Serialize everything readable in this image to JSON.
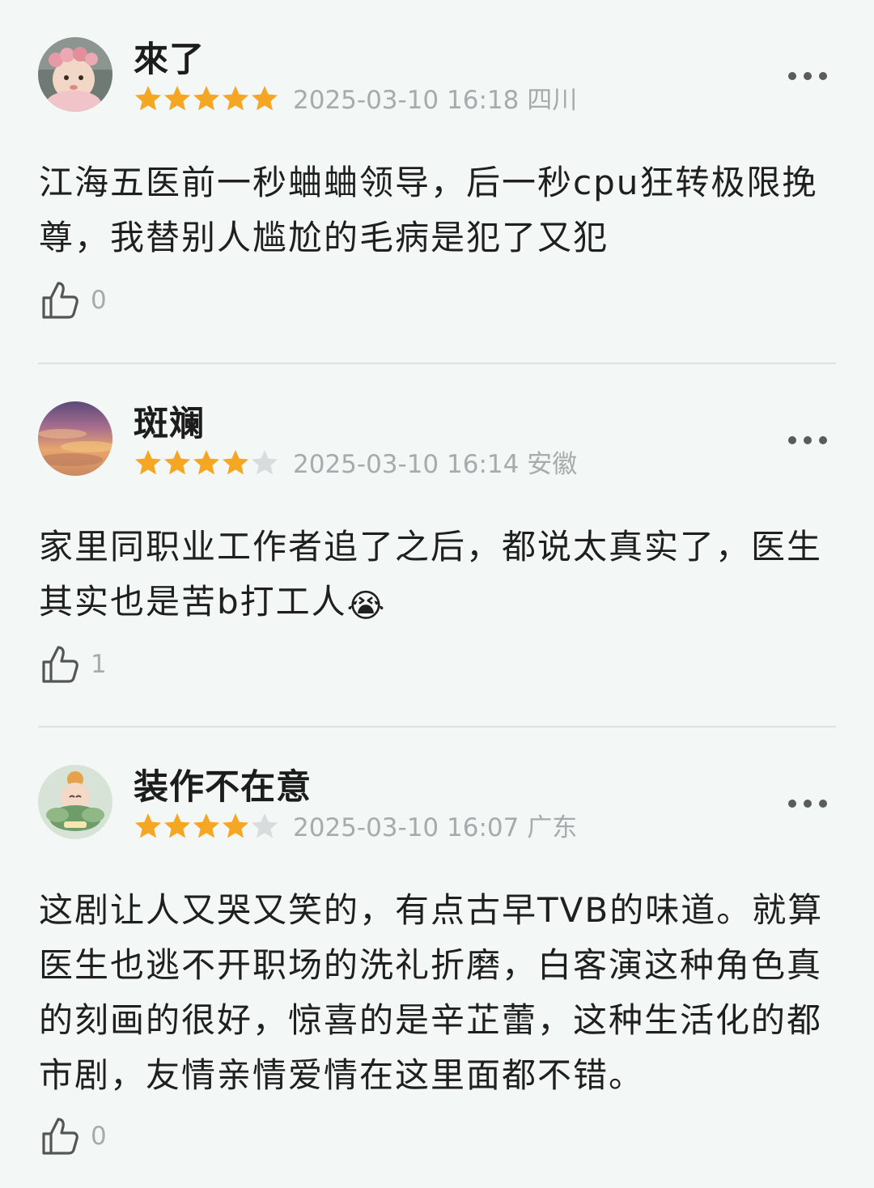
{
  "reviews": [
    {
      "username": "來了",
      "rating": 5,
      "timestamp": "2025-03-10 16:18",
      "location": "四川",
      "content": "江海五医前一秒蛐蛐领导，后一秒cpu狂转极限挽尊，我替别人尴尬的毛病是犯了又犯",
      "likes": "0",
      "avatar_icon": "baby-with-flower-crown-avatar"
    },
    {
      "username": "斑斓",
      "rating": 4,
      "timestamp": "2025-03-10 16:14",
      "location": "安徽",
      "content": "家里同职业工作者追了之后，都说太真实了，医生其实也是苦b打工人",
      "emoji": "😭",
      "likes": "1",
      "avatar_icon": "sunset-clouds-avatar"
    },
    {
      "username": "装作不在意",
      "rating": 4,
      "timestamp": "2025-03-10 16:07",
      "location": "广东",
      "content": "这剧让人又哭又笑的，有点古早TVB的味道。就算医生也逃不开职场的洗礼折磨，白客演这种角色真的刻画的很好，惊喜的是辛芷蕾，这种生活化的都市剧，友情亲情爱情在这里面都不错。",
      "likes": "0",
      "avatar_icon": "baby-in-lotus-avatar"
    }
  ],
  "colors": {
    "background": "#f3f7f6",
    "star_filled": "#f5a623",
    "star_empty": "#d9dcdc",
    "meta_text": "#a7abab",
    "divider": "#dde2e1"
  }
}
